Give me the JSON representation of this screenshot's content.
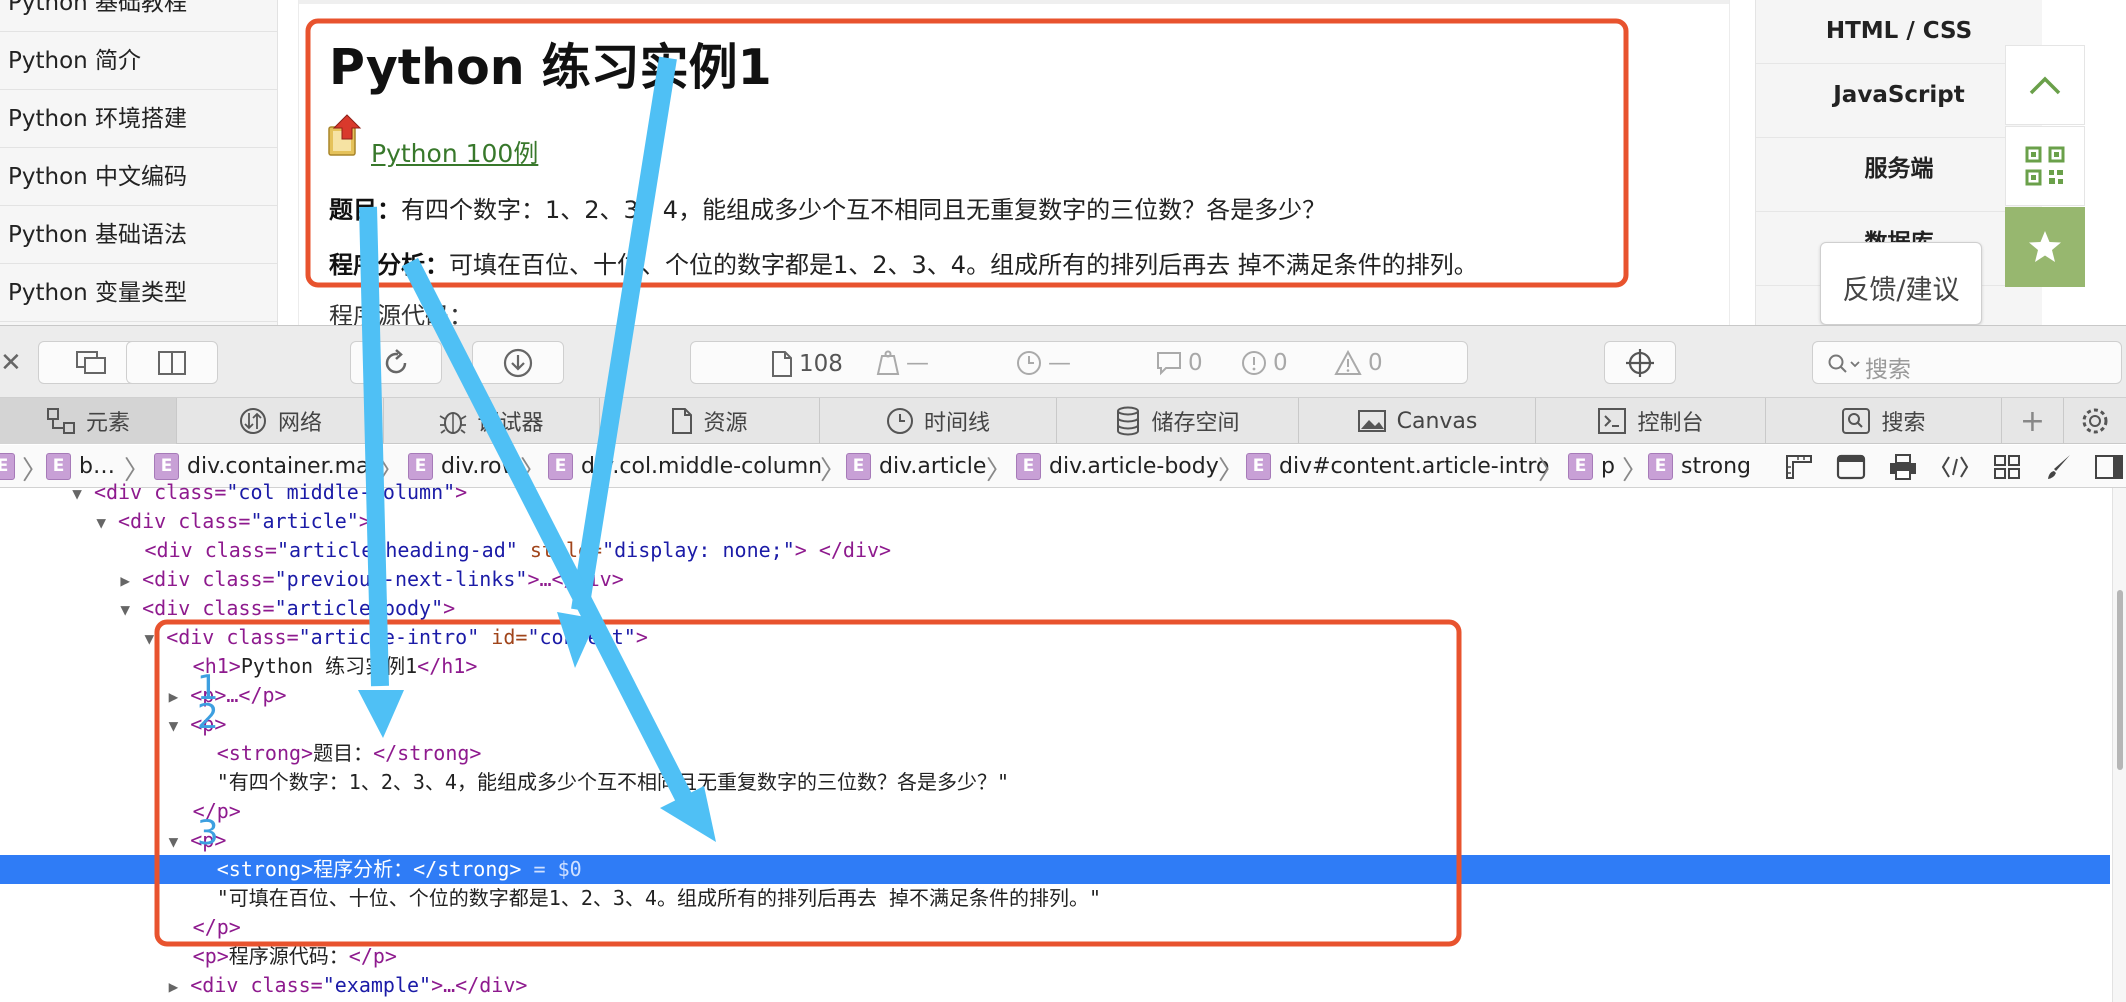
{
  "webpage": {
    "nav_items": [
      "Python 基础教程",
      "Python 简介",
      "Python 环境搭建",
      "Python 中文编码",
      "Python 基础语法",
      "Python 变量类型"
    ],
    "article": {
      "title": "Python 练习实例1",
      "link_label": " Python 100例",
      "q1_label": "题目：",
      "q1_text": "有四个数字：1、2、3、4，能组成多少个互不相同且无重复数字的三位数？各是多少？",
      "q2_label": "程序分析：",
      "q2_text": "可填在百位、十位、个位的数字都是1、2、3、4。组成所有的排列后再去 掉不满足条件的排列。",
      "source_label": "程序源代码："
    },
    "right_col": [
      "HTML / CSS",
      "JavaScript",
      "服务端",
      "数据库"
    ],
    "float_tools": {
      "top_icon": "chevron-up-icon",
      "qr_icon": "qr-code-icon",
      "star_icon": "star-icon"
    },
    "feedback_label": "反馈/建议"
  },
  "devtools": {
    "toolbar": {
      "resources_count": "108",
      "stats": [
        "—",
        "—",
        "0",
        "0",
        "0"
      ],
      "search_placeholder": "搜索"
    },
    "tabs": [
      "元素",
      "网络",
      "调试器",
      "资源",
      "时间线",
      "储存空间",
      "Canvas",
      "控制台",
      "搜索"
    ],
    "breadcrumb": [
      "b…",
      "div.container.mai",
      "div.row",
      "div.col.middle-column",
      "div.article",
      "div.article-body",
      "div#content.article-intro",
      "p",
      "strong"
    ],
    "dom": {
      "l0_tag": "<div class=",
      "l0_val": "\"col middle-column\"",
      "l0_end": ">",
      "l1_tag": "<div class=",
      "l1_val": "\"article\"",
      "l1_end": ">",
      "l2_tag": "<div class=",
      "l2_val": "\"article-heading-ad\"",
      "l2_attr": " style=",
      "l2_val2": "\"display: none;\"",
      "l2_end": "> </div>",
      "l3_tag": "<div class=",
      "l3_val": "\"previous-next-links\"",
      "l3_end": ">…</div>",
      "l4_tag": "<div class=",
      "l4_val": "\"article-body\"",
      "l4_end": ">",
      "l5_tag": "<div class=",
      "l5_val": "\"article-intro\"",
      "l5_attr": " id=",
      "l5_val2": "\"content\"",
      "l5_end": ">",
      "l6_open": "<h1>",
      "l6_text": "Python 练习实例1",
      "l6_close": "</h1>",
      "l7": "<p>…</p>",
      "l8": "<p>",
      "l9_open": "<strong>",
      "l9_text": "题目：",
      "l9_close": "</strong>",
      "l10": "\"有四个数字：1、2、3、4，能组成多少个互不相同且无重复数字的三位数？各是多少？\"",
      "l11": "</p>",
      "l12": "<p>",
      "l13_open": "<strong>",
      "l13_text": "程序分析：",
      "l13_close": "</strong>",
      "l13_ref": " = $0",
      "l14": "\"可填在百位、十位、个位的数字都是1、2、3、4。组成所有的排列后再去 掉不满足条件的排列。\"",
      "l15": "</p>",
      "l16_open": "<p>",
      "l16_text": "程序源代码：",
      "l16_close": "</p>",
      "l17_tag": "<div class=",
      "l17_val": "\"example\"",
      "l17_end": ">…</div>"
    },
    "number_labels": [
      "1",
      "2",
      "3"
    ]
  },
  "annotation": {
    "box_color": "#e8532e",
    "arrow_color": "#4fc0f5",
    "selected_row_color": "#2f7cf6"
  }
}
